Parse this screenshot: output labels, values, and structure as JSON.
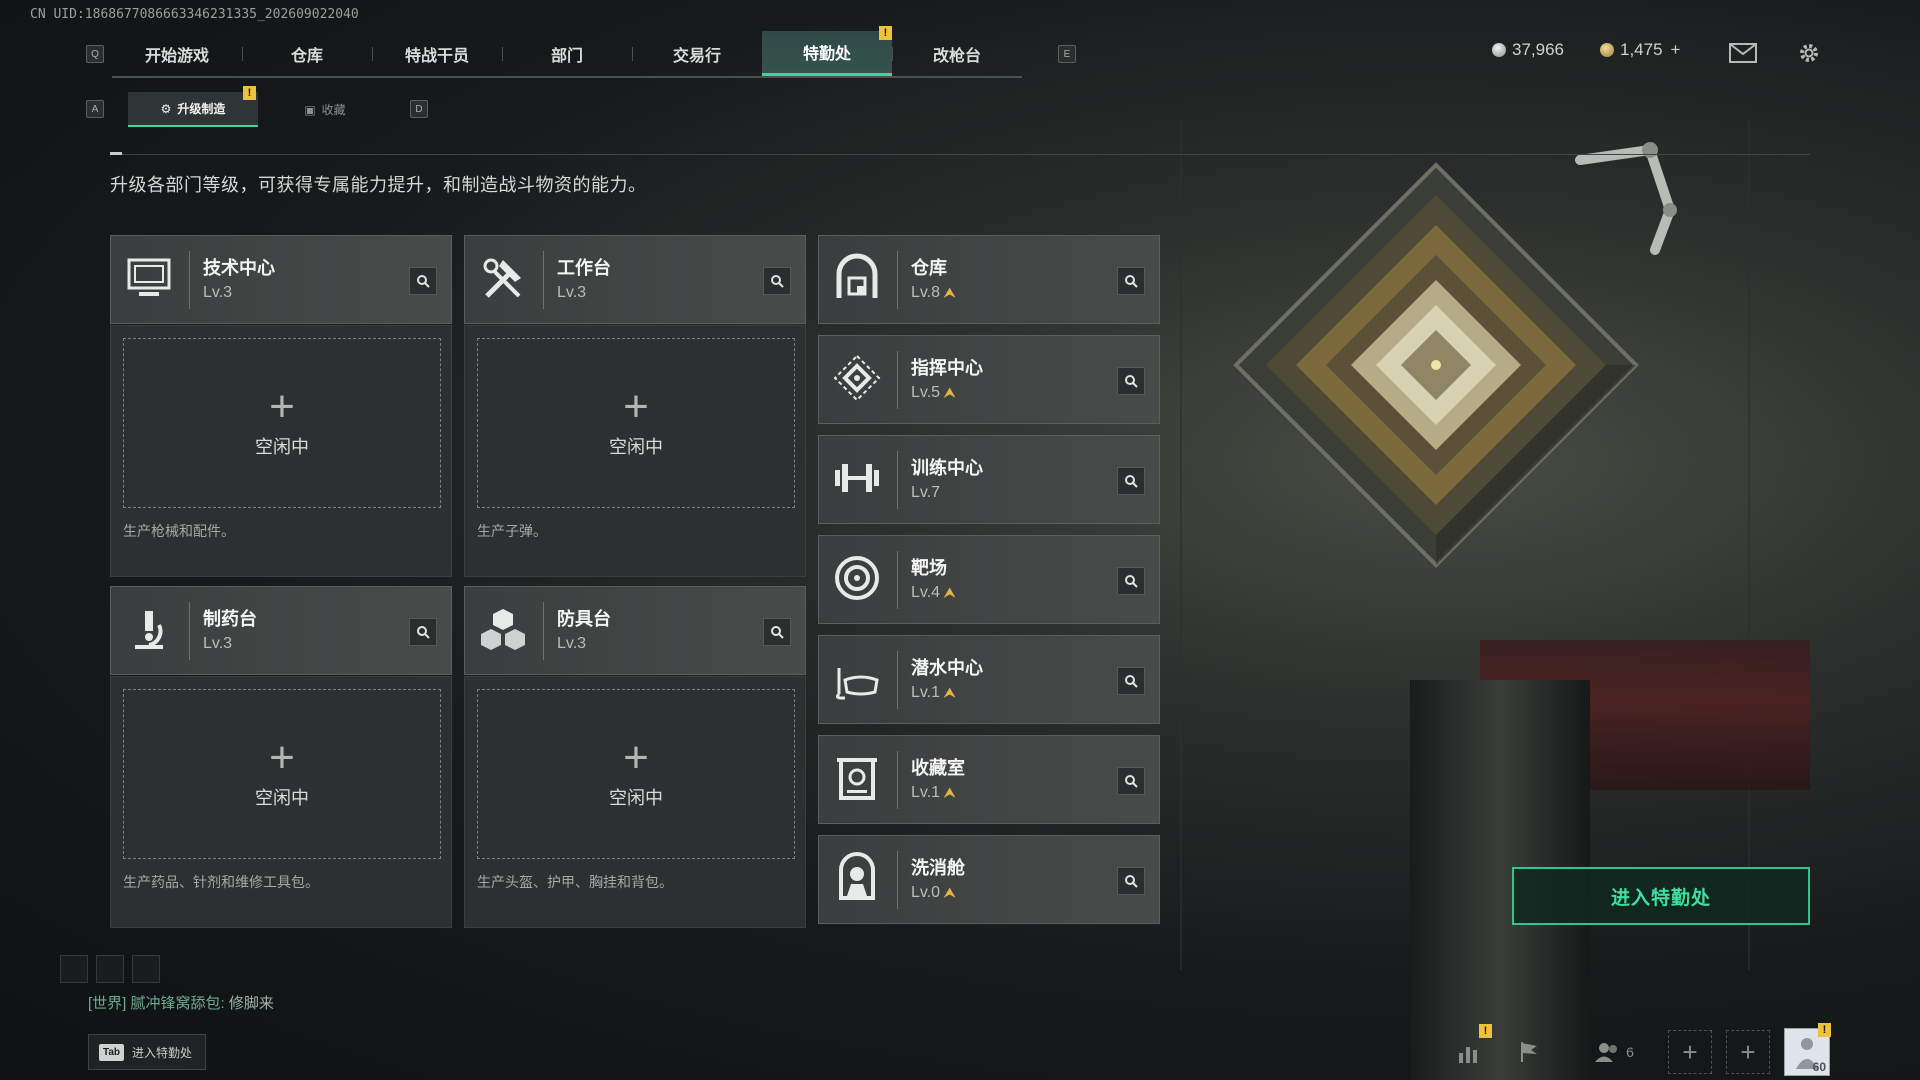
{
  "uid_text": "CN UID:1868677086663346231335_202609022040",
  "nav": {
    "left_key": "Q",
    "right_key": "E",
    "tabs": [
      {
        "label": "开始游戏"
      },
      {
        "label": "仓库"
      },
      {
        "label": "特战干员"
      },
      {
        "label": "部门"
      },
      {
        "label": "交易行"
      },
      {
        "label": "特勤处",
        "active": true,
        "badge": "!"
      },
      {
        "label": "改枪台"
      }
    ]
  },
  "currency": {
    "silver": "37,966",
    "gold": "1,475",
    "gold_add": "+"
  },
  "subtabs": {
    "left_key": "A",
    "right_key": "D",
    "items": [
      {
        "label": "升级制造",
        "active": true,
        "badge": "!"
      },
      {
        "label": "收藏"
      }
    ]
  },
  "description": "升级各部门等级，可获得专属能力提升，和制造战斗物资的能力。",
  "production": [
    {
      "title": "技术中心",
      "level": "Lv.3",
      "icon": "computer-icon",
      "slot_status": "空闲中",
      "slot_desc": "生产枪械和配件。"
    },
    {
      "title": "工作台",
      "level": "Lv.3",
      "icon": "tools-icon",
      "slot_status": "空闲中",
      "slot_desc": "生产子弹。"
    },
    {
      "title": "制药台",
      "level": "Lv.3",
      "icon": "microscope-icon",
      "slot_status": "空闲中",
      "slot_desc": "生产药品、针剂和维修工具包。"
    },
    {
      "title": "防具台",
      "level": "Lv.3",
      "icon": "armor-boxes-icon",
      "slot_status": "空闲中",
      "slot_desc": "生产头盔、护甲、胸挂和背包。"
    }
  ],
  "departments": [
    {
      "title": "仓库",
      "level": "Lv.8",
      "upgradable": true,
      "icon": "warehouse-icon"
    },
    {
      "title": "指挥中心",
      "level": "Lv.5",
      "upgradable": true,
      "icon": "command-diamond-icon"
    },
    {
      "title": "训练中心",
      "level": "Lv.7",
      "upgradable": false,
      "icon": "dumbbell-icon"
    },
    {
      "title": "靶场",
      "level": "Lv.4",
      "upgradable": true,
      "icon": "target-icon"
    },
    {
      "title": "潜水中心",
      "level": "Lv.1",
      "upgradable": true,
      "icon": "diving-mask-icon"
    },
    {
      "title": "收藏室",
      "level": "Lv.1",
      "upgradable": true,
      "icon": "collection-safe-icon"
    },
    {
      "title": "洗消舱",
      "level": "Lv.0",
      "upgradable": true,
      "icon": "decon-suit-icon"
    }
  ],
  "enter_button": "进入特勤处",
  "chat": {
    "channel": "[世界]",
    "sender": "腻冲锋窝舔包:",
    "message": "修脚来"
  },
  "tab_hint": {
    "key": "Tab",
    "label": "进入特勤处"
  },
  "bottom_bar": {
    "friends_count": "6",
    "player_level": "60"
  },
  "colors": {
    "accent": "#3fd59d",
    "upgrade": "#e7b542",
    "badge": "#f0c23a"
  }
}
